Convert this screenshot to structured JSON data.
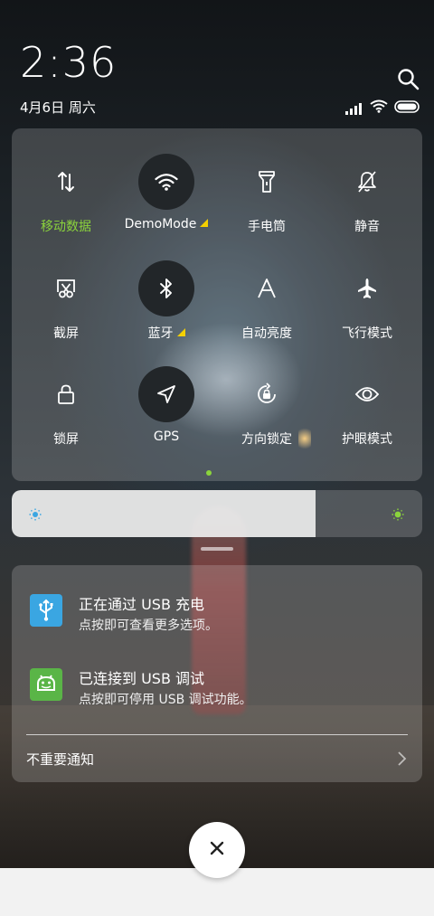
{
  "header": {
    "time": "2:36",
    "date": "4月6日 周六",
    "icons": [
      "search-icon",
      "signal-icon",
      "wifi-icon",
      "battery-icon"
    ]
  },
  "quick_settings": {
    "tiles": [
      {
        "label": "移动数据",
        "icon": "mobile-data-icon",
        "active": true,
        "highlighted": false
      },
      {
        "label": "DemoMode",
        "icon": "wifi-icon",
        "active": false,
        "highlighted": true,
        "has_triangle": true
      },
      {
        "label": "手电筒",
        "icon": "flashlight-icon",
        "active": false,
        "highlighted": false
      },
      {
        "label": "静音",
        "icon": "mute-bell-icon",
        "active": false,
        "highlighted": false
      },
      {
        "label": "截屏",
        "icon": "screenshot-icon",
        "active": false,
        "highlighted": false
      },
      {
        "label": "蓝牙",
        "icon": "bluetooth-icon",
        "active": false,
        "highlighted": true,
        "has_triangle": true
      },
      {
        "label": "自动亮度",
        "icon": "auto-brightness-icon",
        "active": false,
        "highlighted": false
      },
      {
        "label": "飞行模式",
        "icon": "airplane-icon",
        "active": false,
        "highlighted": false
      },
      {
        "label": "锁屏",
        "icon": "lock-icon",
        "active": false,
        "highlighted": false
      },
      {
        "label": "GPS",
        "icon": "gps-icon",
        "active": false,
        "highlighted": true
      },
      {
        "label": "方向锁定",
        "icon": "rotation-lock-icon",
        "active": false,
        "highlighted": false
      },
      {
        "label": "护眼模式",
        "icon": "eye-icon",
        "active": false,
        "highlighted": false
      }
    ],
    "page_indicator_color": "#8bd43c"
  },
  "brightness": {
    "level_fraction": 0.74,
    "min_icon": "sun-small-icon",
    "max_icon": "sun-large-icon",
    "accent": "#8bd43c"
  },
  "notifications": {
    "items": [
      {
        "title": "正在通过 USB 充电",
        "subtitle": "点按即可查看更多选项。",
        "icon": "usb-icon",
        "icon_color": "#3aa6e2"
      },
      {
        "title": "已连接到 USB 调试",
        "subtitle": "点按即可停用 USB 调试功能。",
        "icon": "android-debug-icon",
        "icon_color": "#5ab547"
      }
    ],
    "unimportant_label": "不重要通知"
  },
  "close_button": {
    "icon": "close-icon"
  }
}
